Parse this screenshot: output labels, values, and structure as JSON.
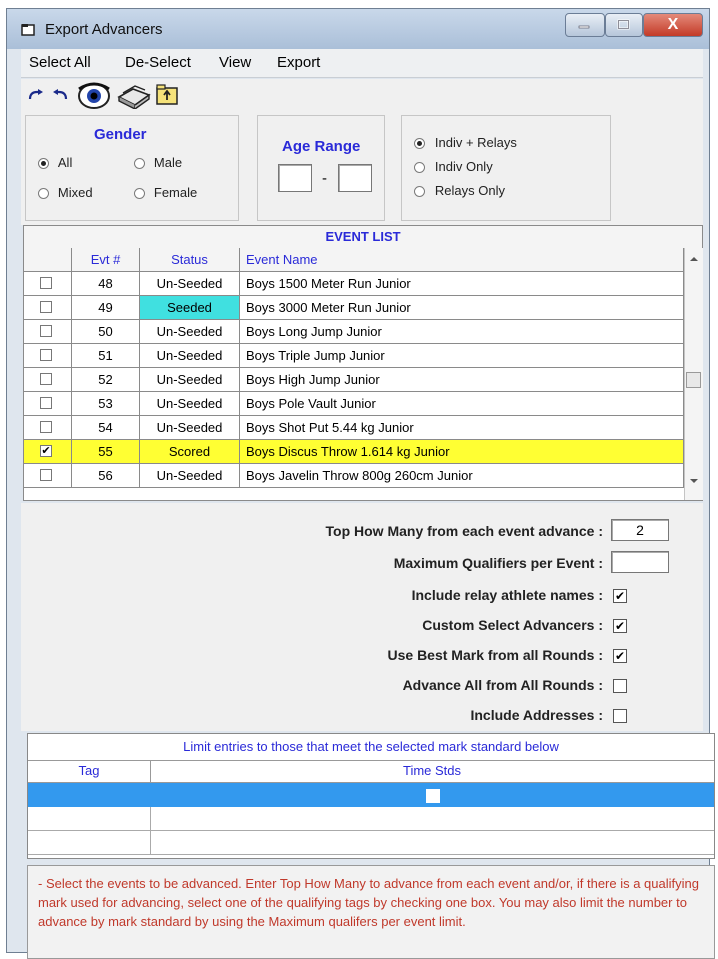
{
  "window": {
    "title": "Export Advancers",
    "close_glyph": "X"
  },
  "menu": [
    "Select All",
    "De-Select",
    "View",
    "Export"
  ],
  "toolbar": {
    "icons": [
      "redo-icon",
      "undo-icon",
      "eye-icon",
      "books-icon",
      "folder-up-icon"
    ]
  },
  "gender": {
    "title": "Gender",
    "options": [
      {
        "label": "All",
        "selected": true
      },
      {
        "label": "Male",
        "selected": false
      },
      {
        "label": "Mixed",
        "selected": false
      },
      {
        "label": "Female",
        "selected": false
      }
    ]
  },
  "age_range": {
    "title": "Age Range",
    "from": "",
    "to": "",
    "separator": "-"
  },
  "entry_type": {
    "options": [
      {
        "label": "Indiv + Relays",
        "selected": true
      },
      {
        "label": "Indiv Only",
        "selected": false
      },
      {
        "label": "Relays Only",
        "selected": false
      }
    ]
  },
  "event_list": {
    "title": "EVENT LIST",
    "columns": [
      "",
      "Evt #",
      "Status",
      "Event Name"
    ],
    "rows": [
      {
        "checked": false,
        "evt": "48",
        "status": "Un-Seeded",
        "name": "Boys 1500 Meter Run Junior"
      },
      {
        "checked": false,
        "evt": "49",
        "status": "Seeded",
        "name": "Boys 3000 Meter Run Junior"
      },
      {
        "checked": false,
        "evt": "50",
        "status": "Un-Seeded",
        "name": "Boys Long Jump Junior"
      },
      {
        "checked": false,
        "evt": "51",
        "status": "Un-Seeded",
        "name": "Boys Triple Jump Junior"
      },
      {
        "checked": false,
        "evt": "52",
        "status": "Un-Seeded",
        "name": "Boys High Jump Junior"
      },
      {
        "checked": false,
        "evt": "53",
        "status": "Un-Seeded",
        "name": "Boys Pole Vault Junior"
      },
      {
        "checked": false,
        "evt": "54",
        "status": "Un-Seeded",
        "name": "Boys Shot Put 5.44 kg Junior"
      },
      {
        "checked": true,
        "evt": "55",
        "status": "Scored",
        "name": "Boys Discus Throw 1.614 kg Junior"
      },
      {
        "checked": false,
        "evt": "56",
        "status": "Un-Seeded",
        "name": "Boys Javelin Throw 800g 260cm Junior"
      }
    ],
    "colors": {
      "seeded": "#40e0e0",
      "highlight": "#ffff33"
    }
  },
  "form": {
    "top_how_many": {
      "label": "Top How Many from each event advance :",
      "value": "2"
    },
    "max_qualifiers": {
      "label": "Maximum Qualifiers per Event :",
      "value": ""
    },
    "checks": [
      {
        "label": "Include relay athlete names :",
        "checked": true
      },
      {
        "label": "Custom Select Advancers :",
        "checked": true
      },
      {
        "label": "Use Best Mark from all Rounds :",
        "checked": true
      },
      {
        "label": "Advance All from All Rounds :",
        "checked": false
      },
      {
        "label": "Include Addresses :",
        "checked": false
      }
    ]
  },
  "limit_table": {
    "title": "Limit entries to those that meet the selected mark standard below",
    "columns": [
      "Tag",
      "Time Stds"
    ],
    "selected_color": "#3399ee"
  },
  "note": " - Select the events to be advanced.  Enter Top How Many to advance from each event and/or, if there is a qualifying mark used for advancing, select one of the qualifying tags by checking one box.  You may also limit the number to advance by mark standard by using the Maximum qualifers per event limit."
}
